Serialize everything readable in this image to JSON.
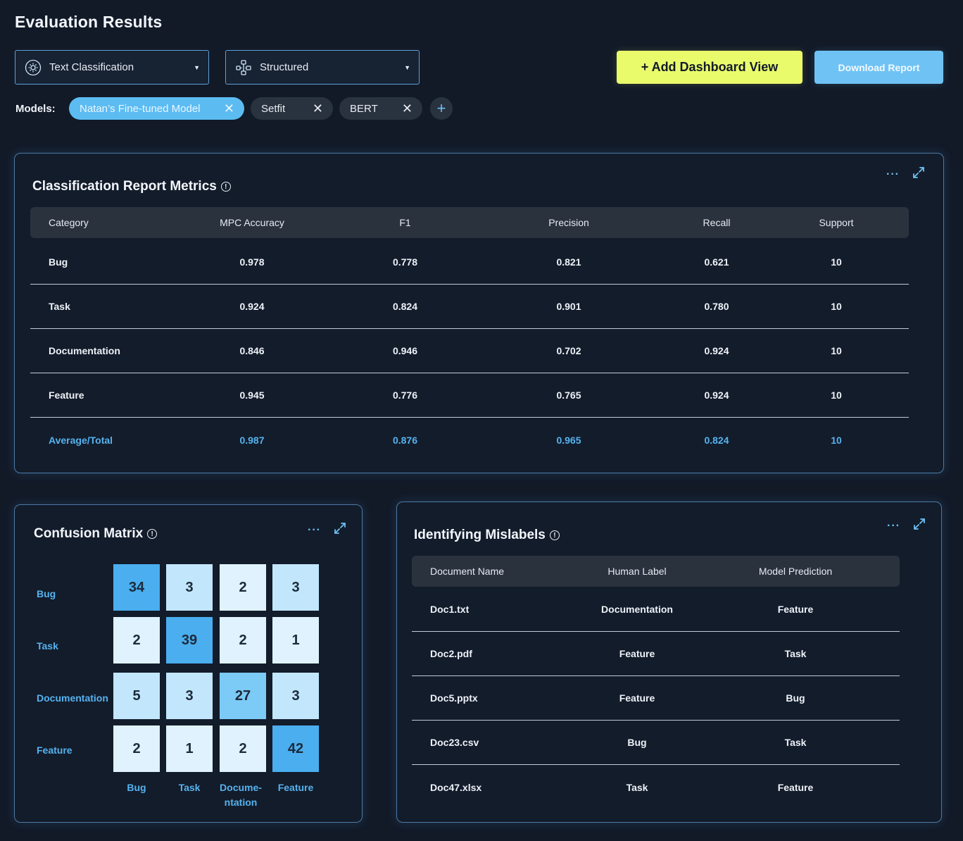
{
  "page_title": "Evaluation Results",
  "filters": {
    "task_dropdown": {
      "label": "Text Classification",
      "icon": "gear-circle-icon"
    },
    "data_dropdown": {
      "label": "Structured",
      "icon": "network-icon"
    }
  },
  "buttons": {
    "add_dashboard": "+ Add Dashboard View",
    "download_report": "Download Report"
  },
  "models": {
    "label": "Models:",
    "chips": [
      {
        "label": "Natan’s Fine-tuned Model",
        "active": true
      },
      {
        "label": "Setfit",
        "active": false
      },
      {
        "label": "BERT",
        "active": false
      }
    ],
    "remove_glyph": "✕",
    "add_glyph": "+"
  },
  "report": {
    "title": "Classification Report Metrics",
    "info": "!",
    "more": "···",
    "expand": "⤢",
    "columns": [
      "Category",
      "MPC Accuracy",
      "F1",
      "Precision",
      "Recall",
      "Support"
    ],
    "rows": [
      [
        "Bug",
        "0.978",
        "0.778",
        "0.821",
        "0.621",
        "10"
      ],
      [
        "Task",
        "0.924",
        "0.824",
        "0.901",
        "0.780",
        "10"
      ],
      [
        "Documentation",
        "0.846",
        "0.946",
        "0.702",
        "0.924",
        "10"
      ],
      [
        "Feature",
        "0.945",
        "0.776",
        "0.765",
        "0.924",
        "10"
      ],
      [
        "Average/Total",
        "0.987",
        "0.876",
        "0.965",
        "0.824",
        "10"
      ]
    ]
  },
  "confusion_matrix": {
    "title": "Confusion Matrix",
    "info": "!",
    "more": "···",
    "expand": "⤢",
    "row_labels": [
      "Bug",
      "Task",
      "Documentation",
      "Feature"
    ],
    "col_labels": [
      "Bug",
      "Task",
      "Docume-\nntation",
      "Feature"
    ],
    "values": [
      [
        "34",
        "3",
        "2",
        "3"
      ],
      [
        "2",
        "39",
        "2",
        "1"
      ],
      [
        "5",
        "3",
        "27",
        "3"
      ],
      [
        "2",
        "1",
        "2",
        "42"
      ]
    ],
    "colors": {
      "strong": "#4aaeef",
      "medium": "#7ccaf6",
      "light": "#c2e6fb",
      "pale": "#dff2fd"
    }
  },
  "mislabels": {
    "title": "Identifying Mislabels",
    "info": "!",
    "more": "···",
    "expand": "⤢",
    "columns": [
      "Document Name",
      "Human Label",
      "Model Prediction"
    ],
    "rows": [
      [
        "Doc1.txt",
        "Documentation",
        "Feature"
      ],
      [
        "Doc2.pdf",
        "Feature",
        "Task"
      ],
      [
        "Doc5.pptx",
        "Feature",
        "Bug"
      ],
      [
        "Doc23.csv",
        "Bug",
        "Task"
      ],
      [
        "Doc47.xlsx",
        "Task",
        "Feature"
      ]
    ]
  }
}
